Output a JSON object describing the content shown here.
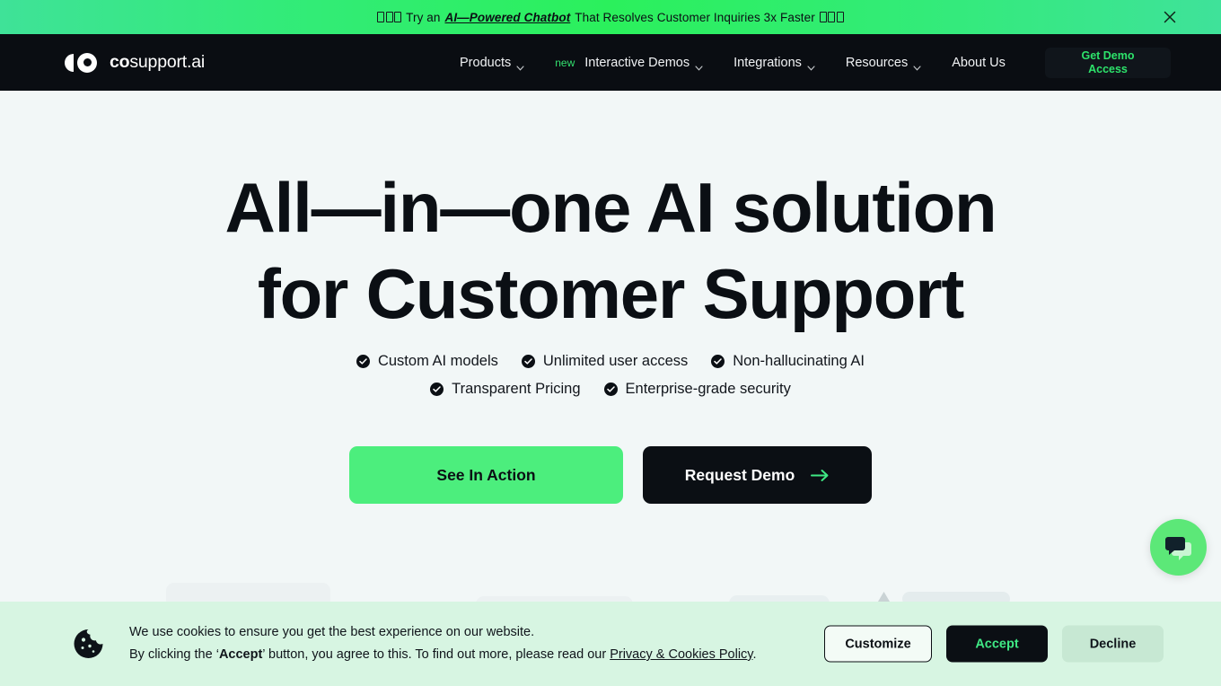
{
  "announcement": {
    "prefix": "Try an ",
    "link_text": "AI—Powered Chatbot",
    "suffix": " That Resolves Customer Inquiries 3x Faster",
    "close_icon": "close-icon"
  },
  "navbar": {
    "logo_bold": "co",
    "logo_rest": "support.ai",
    "items": [
      {
        "label": "Products",
        "badge": "",
        "has_caret": true
      },
      {
        "label": "Interactive Demos",
        "badge": "new",
        "has_caret": true
      },
      {
        "label": "Integrations",
        "badge": "",
        "has_caret": true
      },
      {
        "label": "Resources",
        "badge": "",
        "has_caret": true
      },
      {
        "label": "About Us",
        "badge": "",
        "has_caret": false
      }
    ],
    "cta_line1": "Get Demo",
    "cta_line2": "Access"
  },
  "hero": {
    "title_line1": "All—in—one AI solution",
    "title_line2": "for Customer Support",
    "features_row1": [
      "Custom AI models",
      "Unlimited user access",
      "Non-hallucinating AI"
    ],
    "features_row2": [
      "Transparent Pricing",
      "Enterprise-grade security"
    ],
    "primary_button": "See In Action",
    "secondary_button": "Request Demo",
    "secondary_button_icon": "arrow-right-icon"
  },
  "chat_widget": {
    "icon": "chat-bubbles-icon"
  },
  "cookie_banner": {
    "icon": "cookie-icon",
    "line1": "We use cookies to ensure you get the best experience on our website.",
    "line2_part1": "By clicking the ‘",
    "line2_accept": "Accept",
    "line2_part2": "’ button, you agree to this. To find out more, please read our ",
    "line2_link": "Privacy & Cookies Policy",
    "line2_end": ".",
    "customize_label": "Customize",
    "accept_label": "Accept",
    "decline_label": "Decline"
  },
  "colors": {
    "brand_green": "#4CEE7D",
    "announce_green": "#2BF05C",
    "dark": "#0B0F14",
    "hero_bg": "#F2F7F7",
    "cookie_bg": "#D7F5E2",
    "accent_text_green": "#2DE36B"
  }
}
